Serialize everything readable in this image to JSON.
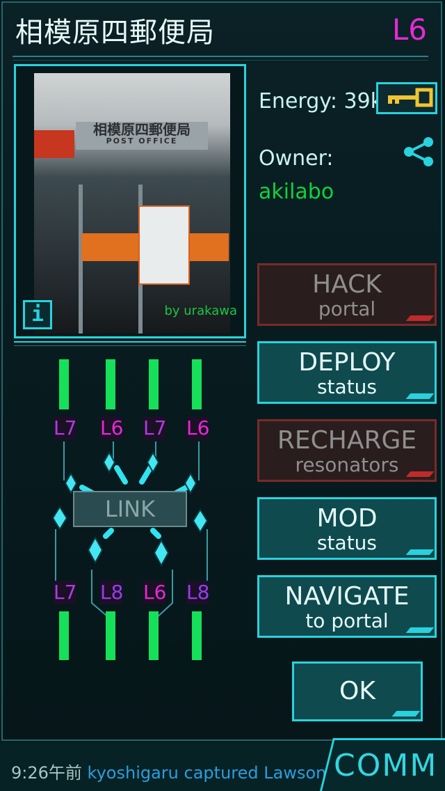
{
  "portal": {
    "name": "相模原四郵便局",
    "level": "L6",
    "photo_credit": "by urakawa",
    "photo_sign_jp": "相模原四郵便局",
    "photo_sign_en": "POST OFFICE",
    "energy_label": "Energy:",
    "energy_value": "39k",
    "owner_label": "Owner:",
    "owner_name": "akilabo",
    "info_icon": "info-icon"
  },
  "actions": [
    {
      "line1": "HACK",
      "line2": "portal",
      "enabled": false
    },
    {
      "line1": "DEPLOY",
      "line2": "status",
      "enabled": true
    },
    {
      "line1": "RECHARGE",
      "line2": "resonators",
      "enabled": false
    },
    {
      "line1": "MOD",
      "line2": "status",
      "enabled": true
    },
    {
      "line1": "NAVIGATE",
      "line2": "to portal",
      "enabled": true
    }
  ],
  "ok_label": "OK",
  "link_label": "LINK",
  "resonators": {
    "top": [
      {
        "level": "L7",
        "color": "#b03be0",
        "charge": 1.0
      },
      {
        "level": "L6",
        "color": "#e52ad4",
        "charge": 1.0
      },
      {
        "level": "L7",
        "color": "#b03be0",
        "charge": 1.0
      },
      {
        "level": "L6",
        "color": "#e52ad4",
        "charge": 1.0
      }
    ],
    "bottom": [
      {
        "level": "L7",
        "color": "#b03be0",
        "charge": 1.0
      },
      {
        "level": "L8",
        "color": "#9a3cf0",
        "charge": 1.0
      },
      {
        "level": "L6",
        "color": "#e52ad4",
        "charge": 1.0
      },
      {
        "level": "L8",
        "color": "#9a3cf0",
        "charge": 1.0
      }
    ]
  },
  "comm": {
    "time": "9:26午前",
    "agent": "kyoshigaru",
    "action": "captured Lawson",
    "tab_label": "COMM"
  },
  "colors": {
    "accent": "#28d3dd",
    "owner": "#10d23f",
    "level": "#e52ad4",
    "disabled_border": "#7a2a2a",
    "resonator_bar": "#16e05a"
  }
}
